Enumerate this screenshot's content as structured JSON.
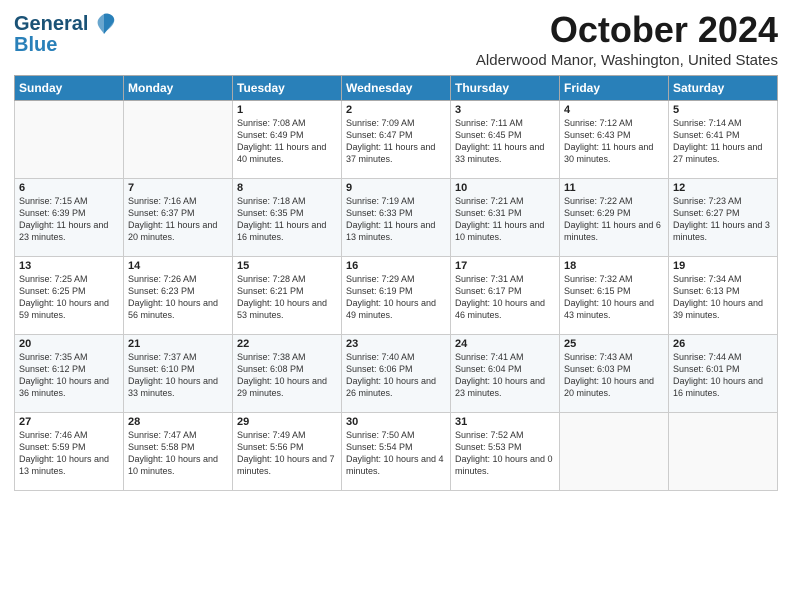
{
  "logo": {
    "line1": "General",
    "line2": "Blue"
  },
  "title": "October 2024",
  "location": "Alderwood Manor, Washington, United States",
  "days_of_week": [
    "Sunday",
    "Monday",
    "Tuesday",
    "Wednesday",
    "Thursday",
    "Friday",
    "Saturday"
  ],
  "weeks": [
    [
      {
        "day": "",
        "info": ""
      },
      {
        "day": "",
        "info": ""
      },
      {
        "day": "1",
        "info": "Sunrise: 7:08 AM\nSunset: 6:49 PM\nDaylight: 11 hours and 40 minutes."
      },
      {
        "day": "2",
        "info": "Sunrise: 7:09 AM\nSunset: 6:47 PM\nDaylight: 11 hours and 37 minutes."
      },
      {
        "day": "3",
        "info": "Sunrise: 7:11 AM\nSunset: 6:45 PM\nDaylight: 11 hours and 33 minutes."
      },
      {
        "day": "4",
        "info": "Sunrise: 7:12 AM\nSunset: 6:43 PM\nDaylight: 11 hours and 30 minutes."
      },
      {
        "day": "5",
        "info": "Sunrise: 7:14 AM\nSunset: 6:41 PM\nDaylight: 11 hours and 27 minutes."
      }
    ],
    [
      {
        "day": "6",
        "info": "Sunrise: 7:15 AM\nSunset: 6:39 PM\nDaylight: 11 hours and 23 minutes."
      },
      {
        "day": "7",
        "info": "Sunrise: 7:16 AM\nSunset: 6:37 PM\nDaylight: 11 hours and 20 minutes."
      },
      {
        "day": "8",
        "info": "Sunrise: 7:18 AM\nSunset: 6:35 PM\nDaylight: 11 hours and 16 minutes."
      },
      {
        "day": "9",
        "info": "Sunrise: 7:19 AM\nSunset: 6:33 PM\nDaylight: 11 hours and 13 minutes."
      },
      {
        "day": "10",
        "info": "Sunrise: 7:21 AM\nSunset: 6:31 PM\nDaylight: 11 hours and 10 minutes."
      },
      {
        "day": "11",
        "info": "Sunrise: 7:22 AM\nSunset: 6:29 PM\nDaylight: 11 hours and 6 minutes."
      },
      {
        "day": "12",
        "info": "Sunrise: 7:23 AM\nSunset: 6:27 PM\nDaylight: 11 hours and 3 minutes."
      }
    ],
    [
      {
        "day": "13",
        "info": "Sunrise: 7:25 AM\nSunset: 6:25 PM\nDaylight: 10 hours and 59 minutes."
      },
      {
        "day": "14",
        "info": "Sunrise: 7:26 AM\nSunset: 6:23 PM\nDaylight: 10 hours and 56 minutes."
      },
      {
        "day": "15",
        "info": "Sunrise: 7:28 AM\nSunset: 6:21 PM\nDaylight: 10 hours and 53 minutes."
      },
      {
        "day": "16",
        "info": "Sunrise: 7:29 AM\nSunset: 6:19 PM\nDaylight: 10 hours and 49 minutes."
      },
      {
        "day": "17",
        "info": "Sunrise: 7:31 AM\nSunset: 6:17 PM\nDaylight: 10 hours and 46 minutes."
      },
      {
        "day": "18",
        "info": "Sunrise: 7:32 AM\nSunset: 6:15 PM\nDaylight: 10 hours and 43 minutes."
      },
      {
        "day": "19",
        "info": "Sunrise: 7:34 AM\nSunset: 6:13 PM\nDaylight: 10 hours and 39 minutes."
      }
    ],
    [
      {
        "day": "20",
        "info": "Sunrise: 7:35 AM\nSunset: 6:12 PM\nDaylight: 10 hours and 36 minutes."
      },
      {
        "day": "21",
        "info": "Sunrise: 7:37 AM\nSunset: 6:10 PM\nDaylight: 10 hours and 33 minutes."
      },
      {
        "day": "22",
        "info": "Sunrise: 7:38 AM\nSunset: 6:08 PM\nDaylight: 10 hours and 29 minutes."
      },
      {
        "day": "23",
        "info": "Sunrise: 7:40 AM\nSunset: 6:06 PM\nDaylight: 10 hours and 26 minutes."
      },
      {
        "day": "24",
        "info": "Sunrise: 7:41 AM\nSunset: 6:04 PM\nDaylight: 10 hours and 23 minutes."
      },
      {
        "day": "25",
        "info": "Sunrise: 7:43 AM\nSunset: 6:03 PM\nDaylight: 10 hours and 20 minutes."
      },
      {
        "day": "26",
        "info": "Sunrise: 7:44 AM\nSunset: 6:01 PM\nDaylight: 10 hours and 16 minutes."
      }
    ],
    [
      {
        "day": "27",
        "info": "Sunrise: 7:46 AM\nSunset: 5:59 PM\nDaylight: 10 hours and 13 minutes."
      },
      {
        "day": "28",
        "info": "Sunrise: 7:47 AM\nSunset: 5:58 PM\nDaylight: 10 hours and 10 minutes."
      },
      {
        "day": "29",
        "info": "Sunrise: 7:49 AM\nSunset: 5:56 PM\nDaylight: 10 hours and 7 minutes."
      },
      {
        "day": "30",
        "info": "Sunrise: 7:50 AM\nSunset: 5:54 PM\nDaylight: 10 hours and 4 minutes."
      },
      {
        "day": "31",
        "info": "Sunrise: 7:52 AM\nSunset: 5:53 PM\nDaylight: 10 hours and 0 minutes."
      },
      {
        "day": "",
        "info": ""
      },
      {
        "day": "",
        "info": ""
      }
    ]
  ]
}
